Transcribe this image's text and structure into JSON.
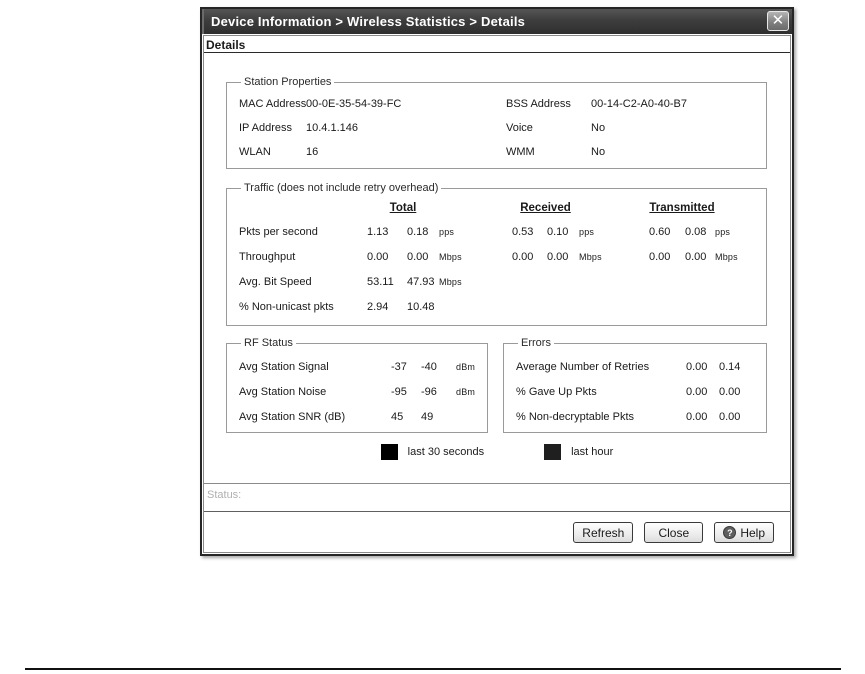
{
  "window": {
    "title": "Device Information > Wireless Statistics > Details",
    "close_icon": "✕",
    "section_header": "Details"
  },
  "station_properties": {
    "legend": "Station Properties",
    "fields": [
      {
        "label": "MAC Address",
        "value": "00-0E-35-54-39-FC"
      },
      {
        "label": "BSS Address",
        "value": "00-14-C2-A0-40-B7"
      },
      {
        "label": "IP Address",
        "value": "10.4.1.146"
      },
      {
        "label": "Voice",
        "value": "No"
      },
      {
        "label": "WLAN",
        "value": "16"
      },
      {
        "label": "WMM",
        "value": "No"
      }
    ]
  },
  "traffic": {
    "legend": "Traffic (does not include retry overhead)",
    "col_total": "Total",
    "col_received": "Received",
    "col_transmitted": "Transmitted",
    "rows": [
      {
        "label": "Pkts per second",
        "t1": "1.13",
        "t2": "0.18",
        "tu": "pps",
        "r1": "0.53",
        "r2": "0.10",
        "ru": "pps",
        "x1": "0.60",
        "x2": "0.08",
        "xu": "pps"
      },
      {
        "label": "Throughput",
        "t1": "0.00",
        "t2": "0.00",
        "tu": "Mbps",
        "r1": "0.00",
        "r2": "0.00",
        "ru": "Mbps",
        "x1": "0.00",
        "x2": "0.00",
        "xu": "Mbps"
      },
      {
        "label": "Avg. Bit Speed",
        "t1": "53.11",
        "t2": "47.93",
        "tu": "Mbps",
        "r1": "",
        "r2": "",
        "ru": "",
        "x1": "",
        "x2": "",
        "xu": ""
      },
      {
        "label": "% Non-unicast pkts",
        "t1": "2.94",
        "t2": "10.48",
        "tu": "",
        "r1": "",
        "r2": "",
        "ru": "",
        "x1": "",
        "x2": "",
        "xu": ""
      }
    ]
  },
  "rf_status": {
    "legend": "RF Status",
    "rows": [
      {
        "label": "Avg Station Signal",
        "v1": "-37",
        "v2": "-40",
        "unit": "dBm"
      },
      {
        "label": "Avg Station Noise",
        "v1": "-95",
        "v2": "-96",
        "unit": "dBm"
      },
      {
        "label": "Avg Station SNR (dB)",
        "v1": "45",
        "v2": "49",
        "unit": ""
      }
    ]
  },
  "errors": {
    "legend": "Errors",
    "rows": [
      {
        "label": "Average Number of Retries",
        "v1": "0.00",
        "v2": "0.14"
      },
      {
        "label": "% Gave Up Pkts",
        "v1": "0.00",
        "v2": "0.00"
      },
      {
        "label": "% Non-decryptable Pkts",
        "v1": "0.00",
        "v2": "0.00"
      }
    ]
  },
  "legend_bar": {
    "items": [
      {
        "label": "last 30 seconds",
        "color": "#000000"
      },
      {
        "label": "last hour",
        "color": "#1f1f1f"
      }
    ]
  },
  "status_bar": {
    "label": "Status:"
  },
  "buttons": {
    "refresh": "Refresh",
    "close": "Close",
    "help": "Help",
    "help_icon": "?"
  }
}
